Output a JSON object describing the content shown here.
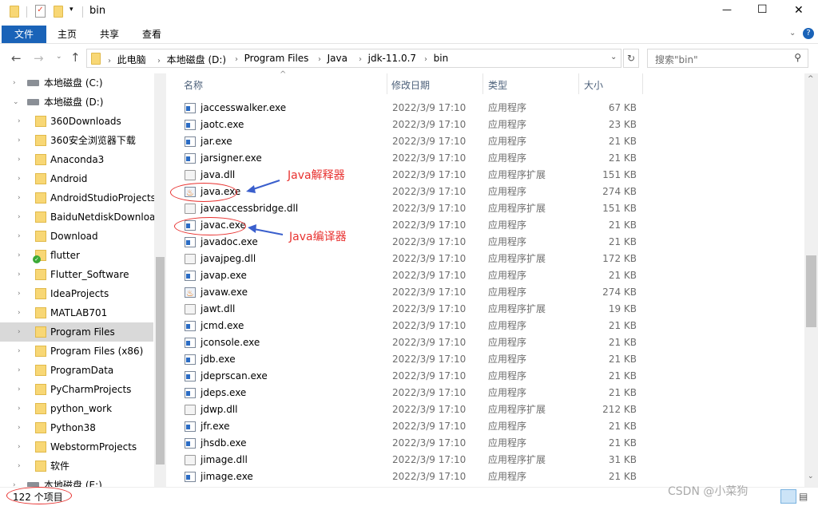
{
  "window": {
    "title": "bin",
    "minimize": "—",
    "maximize": "☐",
    "close": "✕"
  },
  "ribbon": {
    "tabs": [
      "文件",
      "主页",
      "共享",
      "查看"
    ],
    "help": "?"
  },
  "address": {
    "crumbs": [
      "此电脑",
      "本地磁盘 (D:)",
      "Program Files",
      "Java",
      "jdk-11.0.7",
      "bin"
    ],
    "refresh": "↻"
  },
  "search": {
    "placeholder": "搜索\"bin\""
  },
  "sidebar": {
    "items": [
      {
        "label": "本地磁盘 (C:)",
        "icon": "drive-icon",
        "level": 0
      },
      {
        "label": "本地磁盘 (D:)",
        "icon": "drive-icon",
        "level": 0,
        "expanded": true
      },
      {
        "label": "360Downloads",
        "icon": "folder-icon",
        "level": 1
      },
      {
        "label": "360安全浏览器下载",
        "icon": "folder-icon",
        "level": 1
      },
      {
        "label": "Anaconda3",
        "icon": "folder-icon",
        "level": 1
      },
      {
        "label": "Android",
        "icon": "folder-icon",
        "level": 1
      },
      {
        "label": "AndroidStudioProjects",
        "icon": "folder-icon",
        "level": 1
      },
      {
        "label": "BaiduNetdiskDownloa",
        "icon": "folder-icon",
        "level": 1
      },
      {
        "label": "Download",
        "icon": "folder-icon",
        "level": 1
      },
      {
        "label": "flutter",
        "icon": "synced-folder-icon",
        "level": 1
      },
      {
        "label": "Flutter_Software",
        "icon": "folder-icon",
        "level": 1
      },
      {
        "label": "IdeaProjects",
        "icon": "folder-icon",
        "level": 1
      },
      {
        "label": "MATLAB701",
        "icon": "folder-icon",
        "level": 1
      },
      {
        "label": "Program Files",
        "icon": "folder-icon",
        "level": 1,
        "selected": true
      },
      {
        "label": "Program Files (x86)",
        "icon": "folder-icon",
        "level": 1
      },
      {
        "label": "ProgramData",
        "icon": "folder-icon",
        "level": 1
      },
      {
        "label": "PyCharmProjects",
        "icon": "folder-icon",
        "level": 1
      },
      {
        "label": "python_work",
        "icon": "folder-icon",
        "level": 1
      },
      {
        "label": "Python38",
        "icon": "folder-icon",
        "level": 1
      },
      {
        "label": "WebstormProjects",
        "icon": "folder-icon",
        "level": 1
      },
      {
        "label": "软件",
        "icon": "folder-icon",
        "level": 1
      },
      {
        "label": "本地磁盘 (E:)",
        "icon": "drive-icon",
        "level": 0
      }
    ]
  },
  "columns": {
    "name": "名称",
    "date": "修改日期",
    "type": "类型",
    "size": "大小"
  },
  "files": [
    {
      "name": "jaccesswalker.exe",
      "date": "2022/3/9 17:10",
      "type": "应用程序",
      "size": "67 KB",
      "icon": "exe"
    },
    {
      "name": "jaotc.exe",
      "date": "2022/3/9 17:10",
      "type": "应用程序",
      "size": "23 KB",
      "icon": "exe"
    },
    {
      "name": "jar.exe",
      "date": "2022/3/9 17:10",
      "type": "应用程序",
      "size": "21 KB",
      "icon": "exe"
    },
    {
      "name": "jarsigner.exe",
      "date": "2022/3/9 17:10",
      "type": "应用程序",
      "size": "21 KB",
      "icon": "exe"
    },
    {
      "name": "java.dll",
      "date": "2022/3/9 17:10",
      "type": "应用程序扩展",
      "size": "151 KB",
      "icon": "dll"
    },
    {
      "name": "java.exe",
      "date": "2022/3/9 17:10",
      "type": "应用程序",
      "size": "274 KB",
      "icon": "java"
    },
    {
      "name": "javaaccessbridge.dll",
      "date": "2022/3/9 17:10",
      "type": "应用程序扩展",
      "size": "151 KB",
      "icon": "dll"
    },
    {
      "name": "javac.exe",
      "date": "2022/3/9 17:10",
      "type": "应用程序",
      "size": "21 KB",
      "icon": "exe"
    },
    {
      "name": "javadoc.exe",
      "date": "2022/3/9 17:10",
      "type": "应用程序",
      "size": "21 KB",
      "icon": "exe"
    },
    {
      "name": "javajpeg.dll",
      "date": "2022/3/9 17:10",
      "type": "应用程序扩展",
      "size": "172 KB",
      "icon": "dll"
    },
    {
      "name": "javap.exe",
      "date": "2022/3/9 17:10",
      "type": "应用程序",
      "size": "21 KB",
      "icon": "exe"
    },
    {
      "name": "javaw.exe",
      "date": "2022/3/9 17:10",
      "type": "应用程序",
      "size": "274 KB",
      "icon": "java"
    },
    {
      "name": "jawt.dll",
      "date": "2022/3/9 17:10",
      "type": "应用程序扩展",
      "size": "19 KB",
      "icon": "dll"
    },
    {
      "name": "jcmd.exe",
      "date": "2022/3/9 17:10",
      "type": "应用程序",
      "size": "21 KB",
      "icon": "exe"
    },
    {
      "name": "jconsole.exe",
      "date": "2022/3/9 17:10",
      "type": "应用程序",
      "size": "21 KB",
      "icon": "exe"
    },
    {
      "name": "jdb.exe",
      "date": "2022/3/9 17:10",
      "type": "应用程序",
      "size": "21 KB",
      "icon": "exe"
    },
    {
      "name": "jdeprscan.exe",
      "date": "2022/3/9 17:10",
      "type": "应用程序",
      "size": "21 KB",
      "icon": "exe"
    },
    {
      "name": "jdeps.exe",
      "date": "2022/3/9 17:10",
      "type": "应用程序",
      "size": "21 KB",
      "icon": "exe"
    },
    {
      "name": "jdwp.dll",
      "date": "2022/3/9 17:10",
      "type": "应用程序扩展",
      "size": "212 KB",
      "icon": "dll"
    },
    {
      "name": "jfr.exe",
      "date": "2022/3/9 17:10",
      "type": "应用程序",
      "size": "21 KB",
      "icon": "exe"
    },
    {
      "name": "jhsdb.exe",
      "date": "2022/3/9 17:10",
      "type": "应用程序",
      "size": "21 KB",
      "icon": "exe"
    },
    {
      "name": "jimage.dll",
      "date": "2022/3/9 17:10",
      "type": "应用程序扩展",
      "size": "31 KB",
      "icon": "dll"
    },
    {
      "name": "jimage.exe",
      "date": "2022/3/9 17:10",
      "type": "应用程序",
      "size": "21 KB",
      "icon": "exe"
    }
  ],
  "annotations": {
    "java": "Java解释器",
    "javac": "Java编译器",
    "color": "#e8312f",
    "arrow_color": "#3a5fcd"
  },
  "status": {
    "count": "122 个项目"
  },
  "watermark": "CSDN @小菜狗"
}
